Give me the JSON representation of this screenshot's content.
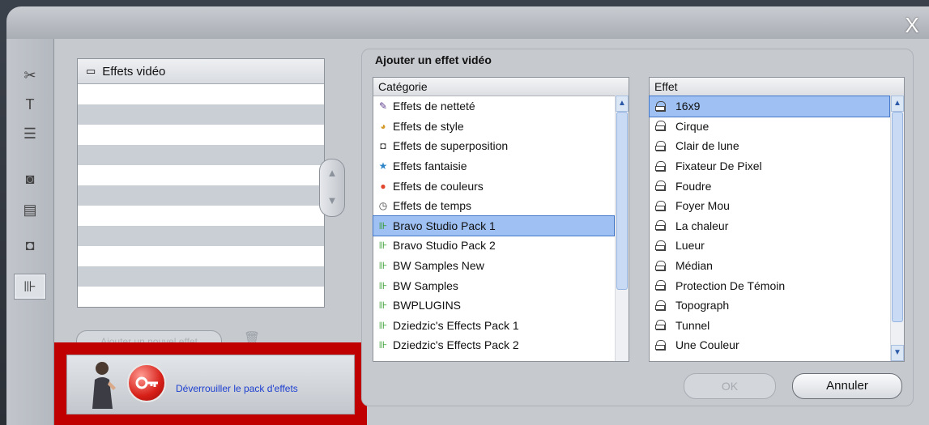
{
  "window": {
    "close_label": "X"
  },
  "toolbar_icons": [
    "scissors-icon",
    "title-icon",
    "menu-icon",
    "camera-icon",
    "clapper-icon",
    "overlay-icon",
    "plugin-icon"
  ],
  "left_panel": {
    "list_title": "Effets vidéo",
    "add_button": "Ajouter un nouvel effet",
    "unlock_label": "Déverrouiller le pack d'effets"
  },
  "dialog": {
    "title": "Ajouter un effet vidéo",
    "category_header": "Catégorie",
    "effect_header": "Effet",
    "categories": [
      {
        "label": "Effets de netteté",
        "icon": "brush-icon"
      },
      {
        "label": "Effets de style",
        "icon": "palette-icon"
      },
      {
        "label": "Effets de superposition",
        "icon": "overlay-icon"
      },
      {
        "label": "Effets fantaisie",
        "icon": "star-icon"
      },
      {
        "label": "Effets de couleurs",
        "icon": "color-wheel-icon"
      },
      {
        "label": "Effets de temps",
        "icon": "clock-icon"
      },
      {
        "label": "Bravo Studio Pack 1",
        "icon": "plugin-icon"
      },
      {
        "label": "Bravo Studio Pack 2",
        "icon": "plugin-icon"
      },
      {
        "label": "BW Samples New",
        "icon": "plugin-icon"
      },
      {
        "label": "BW Samples",
        "icon": "plugin-icon"
      },
      {
        "label": "BWPLUGINS",
        "icon": "plugin-icon"
      },
      {
        "label": "Dziedzic's Effects Pack 1",
        "icon": "plugin-icon"
      },
      {
        "label": "Dziedzic's Effects Pack 2",
        "icon": "plugin-icon"
      }
    ],
    "selected_category": "Bravo Studio Pack 1",
    "effects": [
      "16x9",
      "Cirque",
      "Clair de lune",
      "Fixateur De Pixel",
      "Foudre",
      "Foyer Mou",
      "La chaleur",
      "Lueur",
      "Médian",
      "Protection De Témoin",
      "Topograph",
      "Tunnel",
      "Une Couleur"
    ],
    "selected_effect": "16x9",
    "ok_label": "OK",
    "cancel_label": "Annuler"
  },
  "colors": {
    "highlight": "#c00000",
    "selection": "#9ec0f2",
    "link": "#1d3fd0"
  }
}
